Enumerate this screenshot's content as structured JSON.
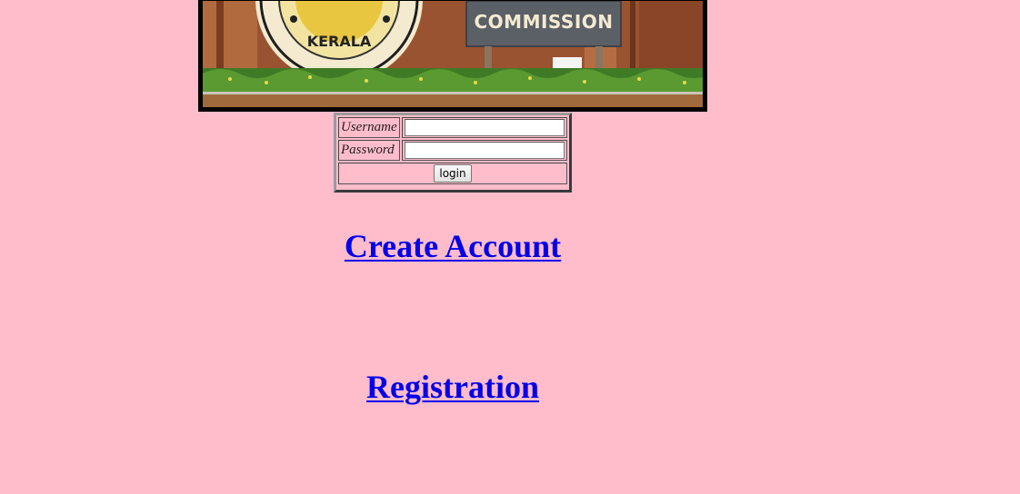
{
  "banner": {
    "seal_text": "KERALA",
    "sign_text": "COMMISSION"
  },
  "login_form": {
    "username_label": "Username",
    "password_label": "Password",
    "username_value": "",
    "password_value": "",
    "login_button": "login"
  },
  "links": {
    "create_account": "Create Account",
    "registration": "Registration"
  },
  "colors": {
    "background": "#ffbccb",
    "link": "#0000ee"
  }
}
